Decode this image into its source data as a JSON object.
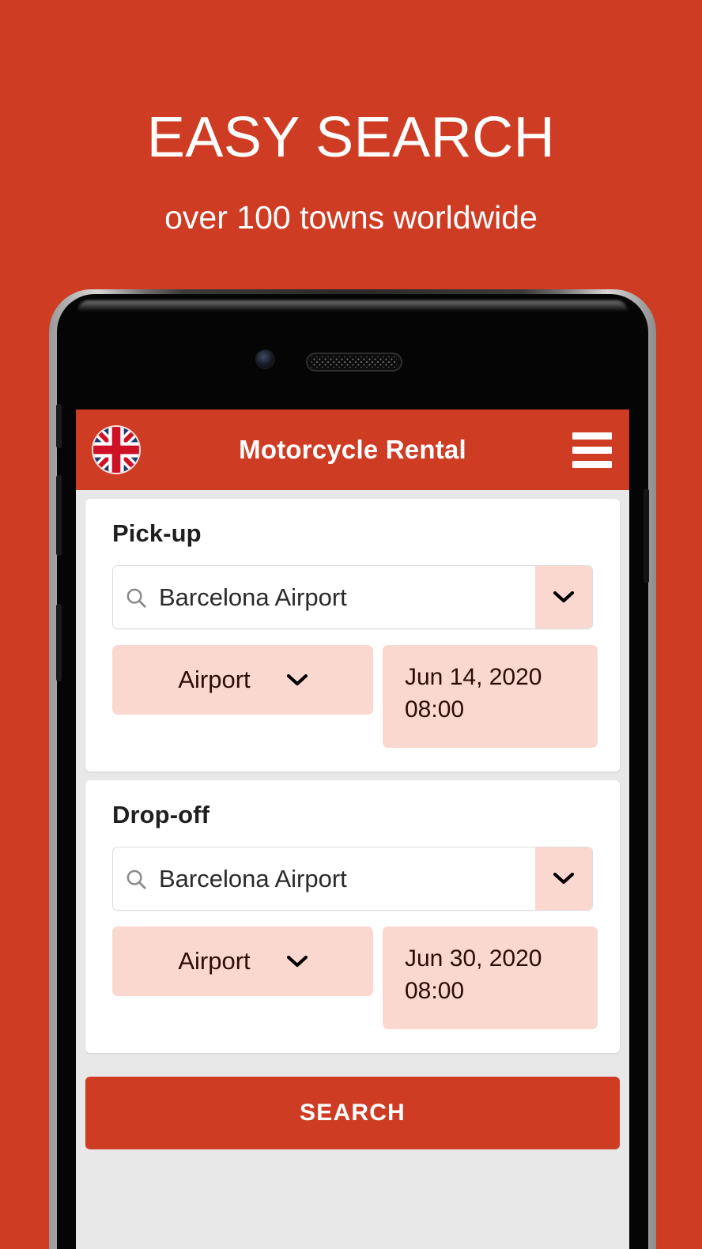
{
  "promo": {
    "title": "EASY SEARCH",
    "subtitle": "over 100 towns worldwide"
  },
  "colors": {
    "brand_orange": "#CE3C23",
    "chip_pink": "#FBD8CF",
    "screen_background": "#E8E8E8",
    "card_white": "#FFFFFF"
  },
  "appbar": {
    "flag_icon": "uk-flag-icon",
    "title": "Motorcycle Rental",
    "menu_icon": "hamburger-menu-icon"
  },
  "pickup": {
    "title": "Pick-up",
    "location": {
      "icon": "search-icon",
      "value": "Barcelona Airport",
      "placeholder": "Barcelona Airport",
      "dropdown_icon": "chevron-down-icon"
    },
    "type": {
      "value": "Airport",
      "dropdown_icon": "chevron-down-icon"
    },
    "datetime": {
      "date": "Jun 14, 2020",
      "time": "08:00"
    }
  },
  "dropoff": {
    "title": "Drop-off",
    "location": {
      "icon": "search-icon",
      "value": "Barcelona Airport",
      "placeholder": "Barcelona Airport",
      "dropdown_icon": "chevron-down-icon"
    },
    "type": {
      "value": "Airport",
      "dropdown_icon": "chevron-down-icon"
    },
    "datetime": {
      "date": "Jun 30, 2020",
      "time": "08:00"
    }
  },
  "actions": {
    "search_label": "SEARCH"
  }
}
